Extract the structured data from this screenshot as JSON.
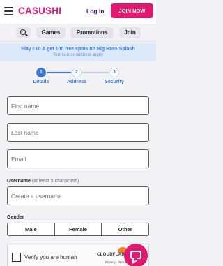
{
  "header": {
    "brand": "CASUSHI",
    "login_label": "Log In",
    "join_now_label": "JOIN NOW"
  },
  "subnav": {
    "items": [
      "Games",
      "Promotions",
      "Join"
    ]
  },
  "promo": {
    "headline": "Play £10 & get 100 free spins on Big Bass Splash",
    "terms": "Terms & conditions apply"
  },
  "steps": [
    {
      "number": "1",
      "label": "Details",
      "active": true
    },
    {
      "number": "2",
      "label": "Address",
      "active": false
    },
    {
      "number": "3",
      "label": "Security",
      "active": false
    }
  ],
  "form": {
    "first_name_placeholder": "First name",
    "last_name_placeholder": "Last name",
    "email_placeholder": "Email",
    "username_label": "Username",
    "username_hint": "(at least 5 characters)",
    "username_placeholder": "Create a username",
    "gender_label": "Gender",
    "gender_options": [
      "Male",
      "Female",
      "Other"
    ]
  },
  "captcha": {
    "text": "Verify you are human",
    "provider": "CLOUDFLARE",
    "links": "Privacy · Terms"
  },
  "colors": {
    "brand_pink": "#e0196e",
    "accent_blue": "#3a78d4",
    "promo_bg": "#dce9fa"
  }
}
